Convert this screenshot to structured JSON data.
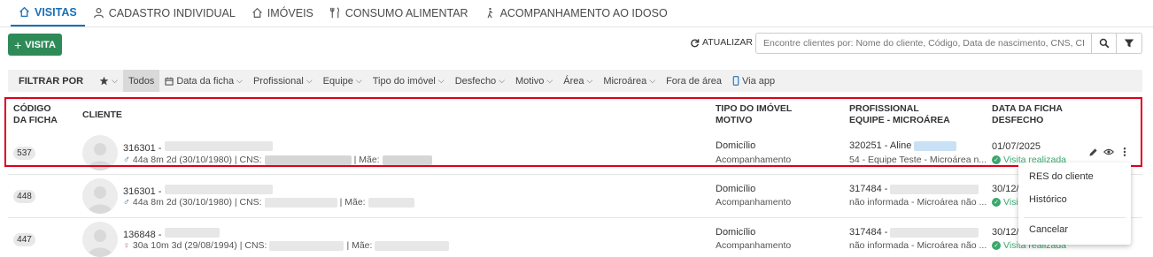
{
  "tabs": [
    {
      "label": "VISITAS",
      "icon": "home-icon",
      "active": true
    },
    {
      "label": "CADASTRO INDIVIDUAL",
      "icon": "user-icon",
      "active": false
    },
    {
      "label": "IMÓVEIS",
      "icon": "house-icon",
      "active": false
    },
    {
      "label": "CONSUMO ALIMENTAR",
      "icon": "utensils-icon",
      "active": false
    },
    {
      "label": "ACOMPANHAMENTO AO IDOSO",
      "icon": "person-walking-icon",
      "active": false
    }
  ],
  "toolbar": {
    "add_label": "VISITA",
    "refresh_label": "ATUALIZAR",
    "search_placeholder": "Encontre clientes por: Nome do cliente, Código, Data de nascimento, CNS, CPF"
  },
  "filters": {
    "label": "FILTRAR POR",
    "items": [
      "Todos",
      "Data da ficha",
      "Profissional",
      "Equipe",
      "Tipo do imóvel",
      "Desfecho",
      "Motivo",
      "Área",
      "Microárea",
      "Fora de área",
      "Via app"
    ]
  },
  "columns": {
    "codigo_1": "CÓDIGO",
    "codigo_2": "DA FICHA",
    "cliente": "CLIENTE",
    "tipo_1": "TIPO DO IMÓVEL",
    "tipo_2": "MOTIVO",
    "prof_1": "PROFISSIONAL",
    "prof_2": "EQUIPE - MICROÁREA",
    "data_1": "DATA DA FICHA",
    "data_2": "DESFECHO"
  },
  "rows": [
    {
      "code": "537",
      "client_id": "316301 -",
      "age": "44a 8m 2d (30/10/1980) | CNS:",
      "mae": "| Mãe:",
      "tipo": "Domicílio",
      "motivo": "Acompanhamento",
      "prof": "320251 - Aline",
      "equipe": "54 - Equipe Teste - Microárea n...",
      "date": "01/07/2025",
      "status": "Visita realizada"
    },
    {
      "code": "448",
      "client_id": "316301 -",
      "age": "44a 8m 2d (30/10/1980) | CNS:",
      "mae": "| Mãe:",
      "tipo": "Domicílio",
      "motivo": "Acompanhamento",
      "prof": "317484 -",
      "equipe": "não informada - Microárea não ...",
      "date": "30/12/",
      "status": "Visi"
    },
    {
      "code": "447",
      "client_id": "136848 -",
      "age": "30a 10m 3d (29/08/1994) | CNS:",
      "mae": "| Mãe:",
      "tipo": "Domicílio",
      "motivo": "Acompanhamento",
      "prof": "317484 -",
      "equipe": "não informada - Microárea não ...",
      "date": "30/12/",
      "status": "Visita realizada"
    }
  ],
  "menu": {
    "items": [
      "RES do cliente",
      "Histórico",
      "Cancelar"
    ]
  },
  "colors": {
    "accent": "#1a6fb5",
    "add_button": "#2e8b57",
    "success": "#3aa76d",
    "highlight": "#e0001b"
  }
}
